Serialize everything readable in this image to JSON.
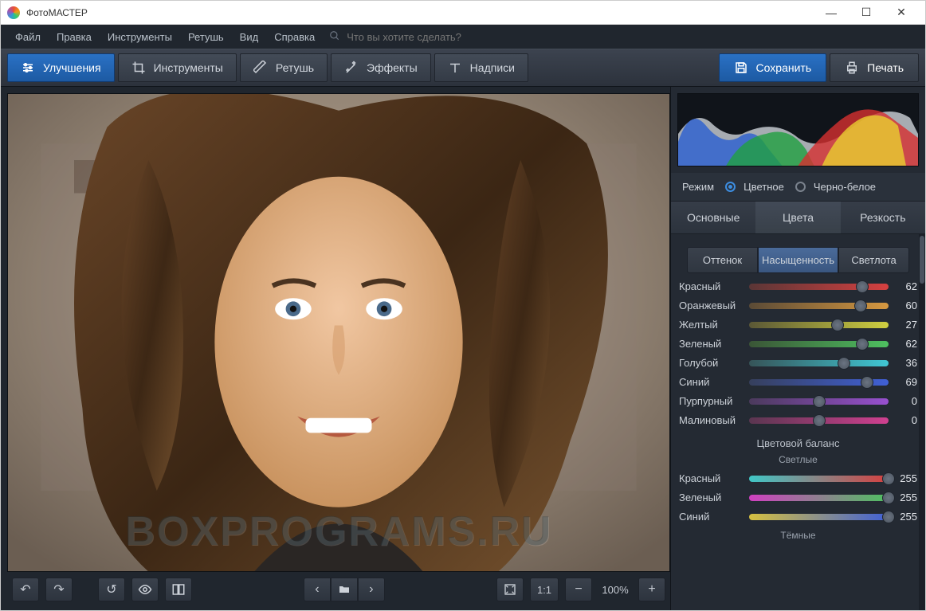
{
  "window": {
    "title": "ФотоМАСТЕР"
  },
  "menu": {
    "items": [
      "Файл",
      "Правка",
      "Инструменты",
      "Ретушь",
      "Вид",
      "Справка"
    ],
    "search_placeholder": "Что вы хотите сделать?"
  },
  "toolbar": {
    "tabs": [
      {
        "label": "Улучшения",
        "active": true
      },
      {
        "label": "Инструменты",
        "active": false
      },
      {
        "label": "Ретушь",
        "active": false
      },
      {
        "label": "Эффекты",
        "active": false
      },
      {
        "label": "Надписи",
        "active": false
      }
    ],
    "save_label": "Сохранить",
    "print_label": "Печать"
  },
  "bottombar": {
    "zoom": "100%",
    "ratio": "1:1"
  },
  "panel": {
    "mode_label": "Режим",
    "mode_color": "Цветное",
    "mode_bw": "Черно-белое",
    "main_tabs": [
      "Основные",
      "Цвета",
      "Резкость"
    ],
    "main_active": 1,
    "sub_tabs": [
      "Оттенок",
      "Насыщенность",
      "Светлота"
    ],
    "sub_active": 1,
    "colors": [
      {
        "name": "Красный",
        "value": 62,
        "grad": [
          "#5a3636",
          "#d64040"
        ]
      },
      {
        "name": "Оранжевый",
        "value": 60,
        "grad": [
          "#5a4a36",
          "#d69840"
        ]
      },
      {
        "name": "Желтый",
        "value": 27,
        "grad": [
          "#5a5736",
          "#cfcf40"
        ]
      },
      {
        "name": "Зеленый",
        "value": 62,
        "grad": [
          "#3a5536",
          "#4ec060"
        ]
      },
      {
        "name": "Голубой",
        "value": 36,
        "grad": [
          "#365458",
          "#40c7d4"
        ]
      },
      {
        "name": "Синий",
        "value": 69,
        "grad": [
          "#363f5c",
          "#4060d6"
        ]
      },
      {
        "name": "Пурпурный",
        "value": 0,
        "grad": [
          "#4b3a5c",
          "#9850d0"
        ]
      },
      {
        "name": "Малиновый",
        "value": 0,
        "grad": [
          "#5a3650",
          "#d04090"
        ]
      }
    ],
    "balance_title": "Цветовой баланс",
    "balance_sub_light": "Светлые",
    "balance_sub_dark": "Тёмные",
    "balance": [
      {
        "name": "Красный",
        "value": 255,
        "grad": [
          "#40c7c7",
          "#d64040"
        ]
      },
      {
        "name": "Зеленый",
        "value": 255,
        "grad": [
          "#d040c0",
          "#4ec060"
        ]
      },
      {
        "name": "Синий",
        "value": 255,
        "grad": [
          "#d6c040",
          "#4060d6"
        ]
      }
    ]
  },
  "watermark": "BOXPROGRAMS.RU"
}
